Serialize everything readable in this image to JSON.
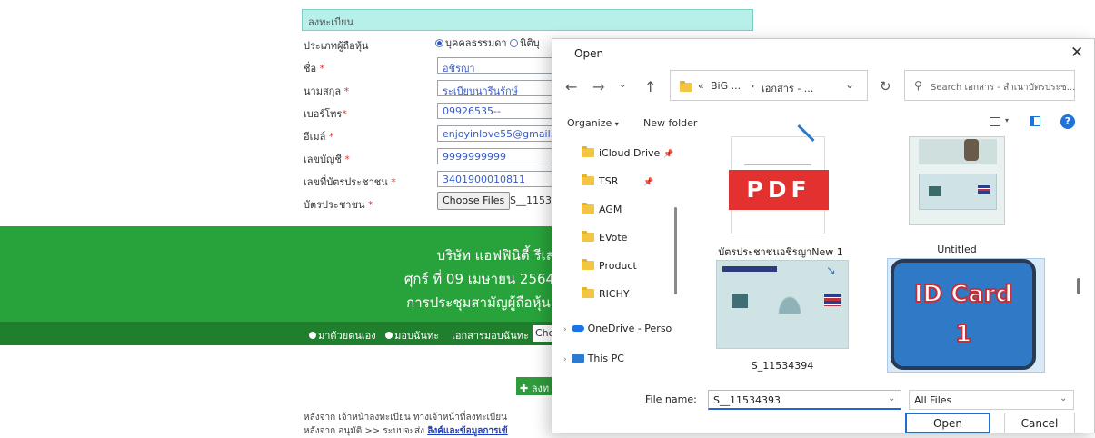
{
  "form": {
    "section_title": "ลงทะเบียน",
    "shareholder_type_label": "ประเภทผู้ถือหุ้น",
    "type_person": "บุคคลธรรมดา",
    "type_juristic": "นิติบุ",
    "first_name_label": "ชื่อ",
    "first_name_value": "อชิรญา",
    "last_name_label": "นามสกุล",
    "last_name_value": "ระเบียบนารีนุรักษ์",
    "phone_label": "เบอร์โทร",
    "phone_value": "09926535--",
    "email_label": "อีเมล์",
    "email_value": "enjoyinlove55@gmail.co",
    "account_label": "เลขบัญชี",
    "account_value": "9999999999",
    "idno_label": "เลขที่บัตรประชาชน",
    "idno_value": "3401900010811",
    "idcard_label": "บัตรประชาชน",
    "required_mark": "*",
    "choose_files": "Choose Files",
    "chosen_file": "S__1153"
  },
  "banner": {
    "line1": "บริษัท แอฟฟินิตี้ รีเลชั่",
    "line2": "ศุกร์ ที่ 09 เมษายน 2564 เ",
    "line3": "การประชุมสามัญผู้ถือหุ้น ป"
  },
  "attendance": {
    "self": "มาด้วยตนเอง",
    "proxy": "มอบฉันทะ",
    "proxy_doc_label": "เอกสารมอบฉันทะ :",
    "proxy_doc_value": "Cho"
  },
  "add_button": "ลงท",
  "info": {
    "line1": "หลังจาก เจ้าหน้าลงทะเบียน ทางเจ้าหน้าที่ลงทะเบียน",
    "line2_prefix": "หลังจาก อนุมัติ >> ระบบจะส่ง",
    "line2_link": "ลิงค์และข้อมูลการเข้"
  },
  "dialog": {
    "title": "Open",
    "close": "✕",
    "path": [
      "«",
      "BiG ...",
      "›",
      "เอกสาร - ..."
    ],
    "search_placeholder": "Search เอกสาร - สำเนาบัตรประช...",
    "organize": "Organize",
    "new_folder": "New folder",
    "nav_items": [
      {
        "label": "iCloud Drive",
        "pinned": true
      },
      {
        "label": "TSR",
        "pinned": true
      },
      {
        "label": "AGM",
        "pinned": false
      },
      {
        "label": "EVote",
        "pinned": false
      },
      {
        "label": "Product",
        "pinned": false
      },
      {
        "label": "RICHY",
        "pinned": false
      },
      {
        "label": "OneDrive - Perso",
        "pinned": false
      },
      {
        "label": "This PC",
        "pinned": false
      }
    ],
    "files": [
      {
        "name": "บัตรประชาชนอชิรญาNew 1",
        "thumb": "PDF"
      },
      {
        "name": "Untitled",
        "thumb": "id-card"
      },
      {
        "name": "S_11534394",
        "thumb": "id-card"
      },
      {
        "name": "",
        "thumb": "ID Card",
        "thumb_line2": "1",
        "selected": true
      }
    ],
    "file_name_label": "File name:",
    "file_name_value": "S__11534393",
    "file_type": "All Files",
    "open_label": "Open",
    "cancel_label": "Cancel"
  },
  "colors": {
    "banner_green": "#28a23a",
    "strip_green": "#1f7f2d",
    "header_teal": "#b7efe9",
    "pdf_red": "#e2312f",
    "idcard_blue": "#2f79c7",
    "dialog_accent": "#1f6fcf"
  }
}
